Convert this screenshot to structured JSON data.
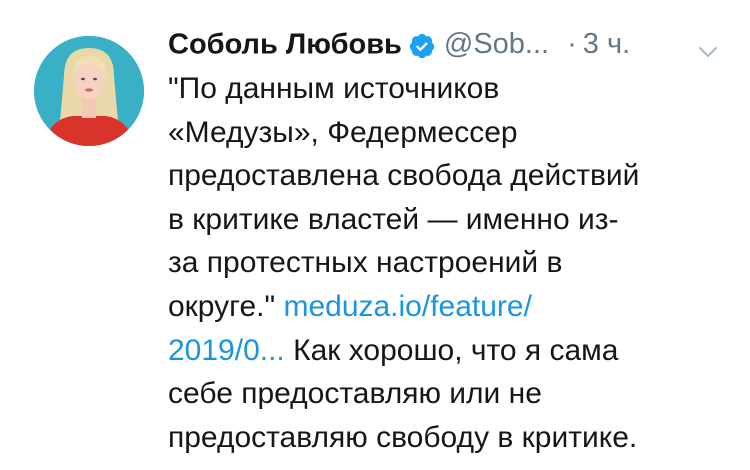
{
  "author": {
    "display_name": "Соболь Любовь",
    "handle": "@Sob...",
    "separator": "·",
    "time": "3 ч."
  },
  "tweet": {
    "lines": [
      "\"По данным источников",
      "«Медузы», Федермессер",
      "предоставлена свобода действий",
      "в критике властей — именно из-",
      "за протестных настроений в"
    ],
    "line6_text": "округе.\" ",
    "link_part1": "meduza.io/feature/",
    "link_part2": "2019/0...",
    "line7_text": " Как хорошо, что я сама",
    "line8_text": "себе предоставляю или не",
    "line9_text": "предоставляю свободу в критике."
  },
  "colors": {
    "link": "#1b95e0",
    "muted": "#657786",
    "verified": "#1da1f2",
    "avatar_bg": "#3ab0c7"
  },
  "icons": {
    "verified": "verified-badge-icon",
    "caret": "chevron-down-icon"
  }
}
